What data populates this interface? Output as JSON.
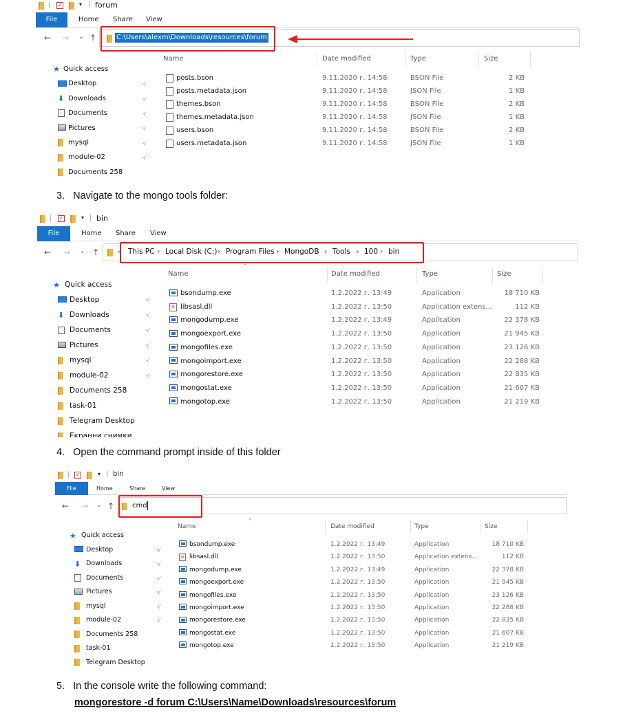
{
  "window1": {
    "title": "forum",
    "tabs": [
      "File",
      "Home",
      "Share",
      "View"
    ],
    "path": "C:\\Users\\alexm\\Downloads\\resources\\forum",
    "columns": {
      "name": "Name",
      "date": "Date modified",
      "type": "Type",
      "size": "Size"
    },
    "sidebar": [
      {
        "label": "Quick access",
        "icon": "star-icon",
        "pinned": false
      },
      {
        "label": "Desktop",
        "icon": "desktop-icon",
        "pinned": true
      },
      {
        "label": "Downloads",
        "icon": "download-arrow-icon",
        "pinned": true
      },
      {
        "label": "Documents",
        "icon": "documents-icon",
        "pinned": true
      },
      {
        "label": "Pictures",
        "icon": "pictures-icon",
        "pinned": true
      },
      {
        "label": "mysql",
        "icon": "folder-icon",
        "pinned": true
      },
      {
        "label": "module-02",
        "icon": "folder-icon",
        "pinned": true
      },
      {
        "label": "Documents 258",
        "icon": "folder-icon",
        "pinned": false
      }
    ],
    "files": [
      {
        "name": "posts.bson",
        "date": "9.11.2020 г. 14:58",
        "type": "BSON File",
        "size": "2 KB"
      },
      {
        "name": "posts.metadata.json",
        "date": "9.11.2020 г. 14:58",
        "type": "JSON File",
        "size": "1 KB"
      },
      {
        "name": "themes.bson",
        "date": "9.11.2020 г. 14:58",
        "type": "BSON File",
        "size": "2 KB"
      },
      {
        "name": "themes.metadata.json",
        "date": "9.11.2020 г. 14:58",
        "type": "JSON File",
        "size": "1 KB"
      },
      {
        "name": "users.bson",
        "date": "9.11.2020 г. 14:58",
        "type": "BSON File",
        "size": "2 KB"
      },
      {
        "name": "users.metadata.json",
        "date": "9.11.2020 г. 14:58",
        "type": "JSON File",
        "size": "1 KB"
      }
    ]
  },
  "step3": {
    "number": "3.",
    "text": "Navigate to the mongo tools folder:"
  },
  "window2": {
    "title": "bin",
    "tabs": [
      "File",
      "Home",
      "Share",
      "View"
    ],
    "breadcrumb": [
      "This PC",
      "Local Disk (C:)",
      "Program Files",
      "MongoDB",
      "Tools",
      "100",
      "bin"
    ],
    "columns": {
      "name": "Name",
      "date": "Date modified",
      "type": "Type",
      "size": "Size"
    },
    "sidebar": [
      {
        "label": "Quick access",
        "icon": "star-icon",
        "pinned": false
      },
      {
        "label": "Desktop",
        "icon": "desktop-icon",
        "pinned": true
      },
      {
        "label": "Downloads",
        "icon": "download-arrow-icon",
        "pinned": true
      },
      {
        "label": "Documents",
        "icon": "documents-icon",
        "pinned": true
      },
      {
        "label": "Pictures",
        "icon": "pictures-icon",
        "pinned": true
      },
      {
        "label": "mysql",
        "icon": "folder-icon",
        "pinned": true
      },
      {
        "label": "module-02",
        "icon": "folder-icon",
        "pinned": true
      },
      {
        "label": "Documents 258",
        "icon": "folder-icon",
        "pinned": false
      },
      {
        "label": "task-01",
        "icon": "folder-icon",
        "pinned": false
      },
      {
        "label": "Telegram Desktop",
        "icon": "folder-icon",
        "pinned": false
      },
      {
        "label": "Екранни снимки",
        "icon": "folder-icon",
        "pinned": false
      }
    ],
    "files": [
      {
        "name": "bsondump.exe",
        "date": "1.2.2022 г. 13:49",
        "type": "Application",
        "size": "18 710 KB",
        "icon": "app"
      },
      {
        "name": "libsasl.dll",
        "date": "1.2.2022 г. 13:50",
        "type": "Application extens...",
        "size": "112 KB",
        "icon": "dll"
      },
      {
        "name": "mongodump.exe",
        "date": "1.2.2022 г. 13:49",
        "type": "Application",
        "size": "22 378 KB",
        "icon": "app"
      },
      {
        "name": "mongoexport.exe",
        "date": "1.2.2022 г. 13:50",
        "type": "Application",
        "size": "21 945 KB",
        "icon": "app"
      },
      {
        "name": "mongofiles.exe",
        "date": "1.2.2022 г. 13:50",
        "type": "Application",
        "size": "23 126 KB",
        "icon": "app"
      },
      {
        "name": "mongoimport.exe",
        "date": "1.2.2022 г. 13:50",
        "type": "Application",
        "size": "22 288 KB",
        "icon": "app"
      },
      {
        "name": "mongorestore.exe",
        "date": "1.2.2022 г. 13:50",
        "type": "Application",
        "size": "22 835 KB",
        "icon": "app"
      },
      {
        "name": "mongostat.exe",
        "date": "1.2.2022 г. 13:50",
        "type": "Application",
        "size": "21 607 KB",
        "icon": "app"
      },
      {
        "name": "mongotop.exe",
        "date": "1.2.2022 г. 13:50",
        "type": "Application",
        "size": "21 219 KB",
        "icon": "app"
      }
    ]
  },
  "step4": {
    "number": "4.",
    "text": "Open the command prompt inside of this folder"
  },
  "window3": {
    "title": "bin",
    "tabs": [
      "File",
      "Home",
      "Share",
      "View"
    ],
    "address_value": "cmd",
    "columns": {
      "name": "Name",
      "date": "Date modified",
      "type": "Type",
      "size": "Size"
    },
    "sidebar": [
      {
        "label": "Quick access",
        "icon": "star-icon",
        "pinned": false
      },
      {
        "label": "Desktop",
        "icon": "desktop-icon",
        "pinned": true
      },
      {
        "label": "Downloads",
        "icon": "download-arrow-icon",
        "pinned": true
      },
      {
        "label": "Documents",
        "icon": "documents-icon",
        "pinned": true
      },
      {
        "label": "Pictures",
        "icon": "pictures-icon",
        "pinned": true
      },
      {
        "label": "mysql",
        "icon": "folder-icon",
        "pinned": true
      },
      {
        "label": "module-02",
        "icon": "folder-icon",
        "pinned": true
      },
      {
        "label": "Documents 258",
        "icon": "folder-icon",
        "pinned": false
      },
      {
        "label": "task-01",
        "icon": "folder-icon",
        "pinned": false
      },
      {
        "label": "Telegram Desktop",
        "icon": "folder-icon",
        "pinned": false
      }
    ],
    "files": [
      {
        "name": "bsondump.exe",
        "date": "1.2.2022 г. 13:49",
        "type": "Application",
        "size": "18 710 KB",
        "icon": "app"
      },
      {
        "name": "libsasl.dll",
        "date": "1.2.2022 г. 13:50",
        "type": "Application extens...",
        "size": "112 KB",
        "icon": "dll"
      },
      {
        "name": "mongodump.exe",
        "date": "1.2.2022 г. 13:49",
        "type": "Application",
        "size": "22 378 KB",
        "icon": "app"
      },
      {
        "name": "mongoexport.exe",
        "date": "1.2.2022 г. 13:50",
        "type": "Application",
        "size": "21 945 KB",
        "icon": "app"
      },
      {
        "name": "mongofiles.exe",
        "date": "1.2.2022 г. 13:50",
        "type": "Application",
        "size": "23 126 KB",
        "icon": "app"
      },
      {
        "name": "mongoimport.exe",
        "date": "1.2.2022 г. 13:50",
        "type": "Application",
        "size": "22 288 KB",
        "icon": "app"
      },
      {
        "name": "mongorestore.exe",
        "date": "1.2.2022 г. 13:50",
        "type": "Application",
        "size": "22 835 KB",
        "icon": "app"
      },
      {
        "name": "mongostat.exe",
        "date": "1.2.2022 г. 13:50",
        "type": "Application",
        "size": "21 607 KB",
        "icon": "app"
      },
      {
        "name": "mongotop.exe",
        "date": "1.2.2022 г. 13:50",
        "type": "Application",
        "size": "21 219 KB",
        "icon": "app"
      }
    ]
  },
  "step5": {
    "number": "5.",
    "text": "In the console write the following command:",
    "command": "mongorestore -d forum C:\\Users\\Name\\Downloads\\resources\\forum"
  },
  "colors": {
    "accent": "#1a73c8",
    "highlight_red": "#e31d1d",
    "folder": "#e8b84a"
  }
}
